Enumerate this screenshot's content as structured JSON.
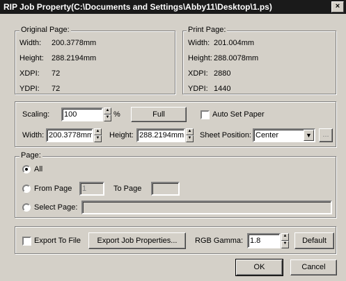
{
  "window": {
    "title": "RIP Job Property(C:\\Documents and Settings\\Abby11\\Desktop\\1.ps)",
    "close_icon": "×"
  },
  "original_page": {
    "legend": "Original Page:",
    "width_label": "Width:",
    "width_value": "200.3778mm",
    "height_label": "Height:",
    "height_value": "288.2194mm",
    "xdpi_label": "XDPI:",
    "xdpi_value": "72",
    "ydpi_label": "YDPI:",
    "ydpi_value": "72"
  },
  "print_page": {
    "legend": "Print Page:",
    "width_label": "Width:",
    "width_value": "201.004mm",
    "height_label": "Height:",
    "height_value": "288.0078mm",
    "xdpi_label": "XDPI:",
    "xdpi_value": "2880",
    "ydpi_label": "YDPI:",
    "ydpi_value": "1440"
  },
  "scaling": {
    "label": "Scaling:",
    "value": "100",
    "unit": "%",
    "full_button": "Full",
    "auto_set_paper_label": "Auto Set Paper",
    "auto_set_paper_checked": false,
    "width_label": "Width:",
    "width_value": "200.3778mm",
    "height_label": "Height:",
    "height_value": "288.2194mm",
    "sheet_position_label": "Sheet Position:",
    "sheet_position_value": "Center",
    "ellipsis_button": "..."
  },
  "page": {
    "legend": "Page:",
    "all_label": "All",
    "from_page_label": "From Page",
    "from_value": "1",
    "to_page_label": "To Page",
    "to_value": "",
    "select_page_label": "Select Page:",
    "select_value": "",
    "selected": "all"
  },
  "export": {
    "export_to_file_label": "Export To File",
    "export_to_file_checked": false,
    "export_job_properties_button": "Export Job Properties...",
    "rgb_gamma_label": "RGB Gamma:",
    "rgb_gamma_value": "1.8",
    "default_button": "Default"
  },
  "footer": {
    "ok_button": "OK",
    "cancel_button": "Cancel"
  }
}
